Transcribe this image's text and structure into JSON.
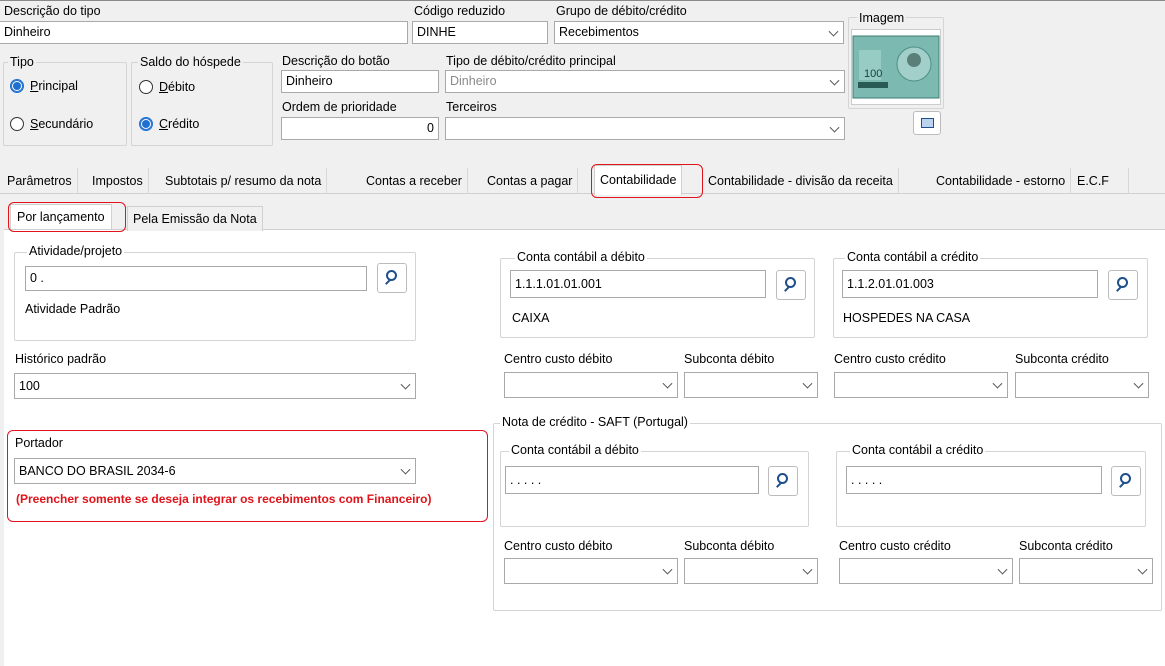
{
  "header": {
    "descricao_tipo": {
      "label": "Descrição do tipo",
      "value": "Dinheiro"
    },
    "codigo_reduzido": {
      "label": "Código reduzido",
      "value": "DINHE"
    },
    "grupo": {
      "label": "Grupo de débito/crédito",
      "value": "Recebimentos"
    },
    "imagem": {
      "label": "Imagem",
      "note_text": "100"
    },
    "tipo": {
      "label": "Tipo",
      "principal": "rincipal",
      "principal_u": "P",
      "secundario": "ecundário",
      "secundario_u": "S",
      "selected": "principal"
    },
    "saldo": {
      "label": "Saldo do hóspede",
      "debito": "ébito",
      "debito_u": "D",
      "credito": "rédito",
      "credito_u": "C",
      "selected": "credito"
    },
    "descricao_botao": {
      "label": "Descrição do botão",
      "value": "Dinheiro"
    },
    "tipo_principal": {
      "label": "Tipo de débito/crédito principal",
      "value": "Dinheiro"
    },
    "ordem": {
      "label": "Ordem de prioridade",
      "value": "0"
    },
    "terceiros": {
      "label": "Terceiros",
      "value": ""
    }
  },
  "tabs": [
    "Parâmetros",
    "Impostos",
    "Subtotais p/ resumo da nota",
    "Contas a receber",
    "Contas a pagar",
    "Contabilidade",
    "Contabilidade - divisão da receita",
    "Contabilidade - estorno",
    "E.C.F"
  ],
  "active_tab": "Contabilidade",
  "subtabs": [
    "Por lançamento",
    "Pela Emissão da Nota"
  ],
  "active_subtab": "Por lançamento",
  "left": {
    "atividade": {
      "label": "Atividade/projeto",
      "value": "0 .",
      "desc": "Atividade Padrão"
    },
    "historico": {
      "label": "Histórico padrão",
      "value": "100"
    },
    "portador": {
      "label": "Portador",
      "value": "BANCO DO BRASIL 2034-6",
      "note": "(Preencher somente se deseja integrar os recebimentos com Financeiro)"
    }
  },
  "lanc": {
    "debito": {
      "label": "Conta contábil a débito",
      "value": "1.1.1.01.01.001",
      "desc": "CAIXA"
    },
    "credito": {
      "label": "Conta contábil a crédito",
      "value": "1.1.2.01.01.003",
      "desc": "HOSPEDES NA CASA"
    },
    "cc_debito": {
      "label": "Centro custo débito",
      "value": ""
    },
    "sub_debito": {
      "label": "Subconta débito",
      "value": ""
    },
    "cc_credito": {
      "label": "Centro custo crédito",
      "value": ""
    },
    "sub_credito": {
      "label": "Subconta crédito",
      "value": ""
    }
  },
  "saft": {
    "title": "Nota de crédito - SAFT (Portugal)",
    "debito": {
      "label": "Conta contábil a débito",
      "value": ". . . . ."
    },
    "credito": {
      "label": "Conta contábil a crédito",
      "value": ". . . . ."
    },
    "cc_debito": {
      "label": "Centro custo débito",
      "value": ""
    },
    "sub_debito": {
      "label": "Subconta débito",
      "value": ""
    },
    "cc_credito": {
      "label": "Centro custo crédito",
      "value": ""
    },
    "sub_credito": {
      "label": "Subconta crédito",
      "value": ""
    }
  },
  "colors": {
    "accent": "#1f6fd1",
    "highlight": "#e0141a",
    "panel": "#f0f0f0"
  }
}
